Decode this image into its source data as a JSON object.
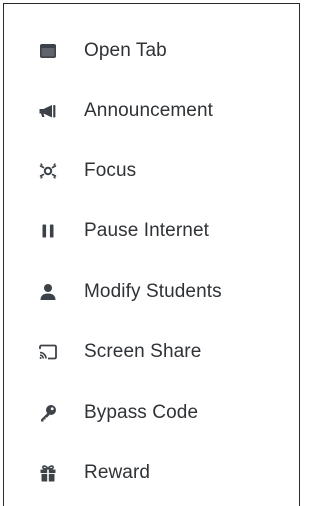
{
  "menu": {
    "items": [
      {
        "label": "Open Tab",
        "icon": "browser-tab-icon"
      },
      {
        "label": "Announcement",
        "icon": "megaphone-icon"
      },
      {
        "label": "Focus",
        "icon": "focus-icon"
      },
      {
        "label": "Pause Internet",
        "icon": "pause-icon"
      },
      {
        "label": "Modify Students",
        "icon": "person-icon"
      },
      {
        "label": "Screen Share",
        "icon": "cast-icon"
      },
      {
        "label": "Bypass Code",
        "icon": "key-icon"
      },
      {
        "label": "Reward",
        "icon": "gift-icon"
      }
    ]
  },
  "colors": {
    "icon": "#3d4248",
    "text": "#2f3337",
    "border": "#2b2b2b"
  }
}
